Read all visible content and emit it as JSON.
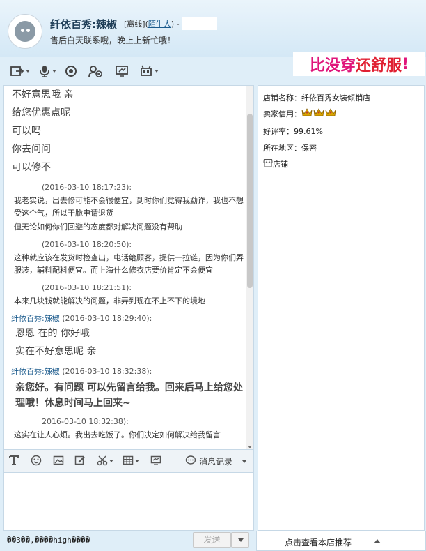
{
  "header": {
    "shop_name": "纤依百秀:辣椒",
    "status_prefix": "[离线](",
    "stranger_link": "陌生人",
    "status_suffix": ") -",
    "signature": "售后白天联系哦，晚上上新忙哦！"
  },
  "banner": {
    "part1": "比没穿",
    "part2": "还舒服",
    "part3": "!"
  },
  "toolbar": {
    "icons": [
      "transfer-file-icon",
      "voice-icon",
      "video-icon",
      "add-contact-icon",
      "remote-assist-icon",
      "application-icon"
    ]
  },
  "chat": {
    "intro_lines": [
      "不好意思哦  亲",
      "给您优惠点呢",
      "可以吗",
      "你去问问",
      "可以修不"
    ],
    "messages": [
      {
        "sender": "",
        "time": "(2016-03-10 18:17:23):",
        "lines": [
          "我老实说，出去修可能不会很便宜，到时你们觉得我勐诈，我也不想受这个气，所以干脆申请退货",
          "但无论如何你们回避的态度都对解决问题没有帮助"
        ]
      },
      {
        "sender": "",
        "time": "(2016-03-10 18:20:50):",
        "lines": [
          "这种就应该在发货时检查出，电话给顾客，提供一拉链，因为你们弄服装，辅料配料便宜。而上海什么修衣店要价肯定不会便宜"
        ]
      },
      {
        "sender": "",
        "time": "(2016-03-10 18:21:51):",
        "lines": [
          "本来几块钱就能解决的问题，非弄到现在不上不下的境地"
        ]
      },
      {
        "sender": "纤依百秀:辣椒",
        "time": "(2016-03-10 18:29:40):",
        "big_lines": [
          "恩恩  在的  你好哦",
          "实在不好意思呢    亲"
        ]
      },
      {
        "sender": "纤依百秀:辣椒",
        "time": "(2016-03-10 18:32:38):",
        "bold_text": "亲您好。有问题 可以先留言给我。回来后马上给您处理哦！休息时间马上回来~"
      },
      {
        "sender": "",
        "time": "2016-03-10 18:32:38):",
        "lines": [
          "这实在让人心烦。我出去吃饭了。你们决定如何解决给我留言"
        ]
      }
    ]
  },
  "input_toolbar": {
    "icons": [
      "font-icon",
      "emoji-icon",
      "image-icon",
      "edit-icon",
      "screenshot-icon",
      "table-icon",
      "screen-share-icon"
    ],
    "history_label": "消息记录"
  },
  "footer": {
    "garbled_text": "��3��,����high����",
    "send_label": "发送"
  },
  "shop_info": {
    "name_label": "店铺名称：",
    "name_value": "纤依百秀女装倾销店",
    "credit_label": "卖家信用：",
    "crown_count": 3,
    "rating_label": "好评率：",
    "rating_value": "99.61%",
    "region_label": "所在地区：",
    "region_value": "保密",
    "shop_link": "店铺",
    "recommend_label": "点击查看本店推荐"
  },
  "colors": {
    "accent": "#1a5a8c",
    "banner_pink": "#e0157a",
    "banner_red": "#e02032",
    "crown": "#d9a400"
  }
}
